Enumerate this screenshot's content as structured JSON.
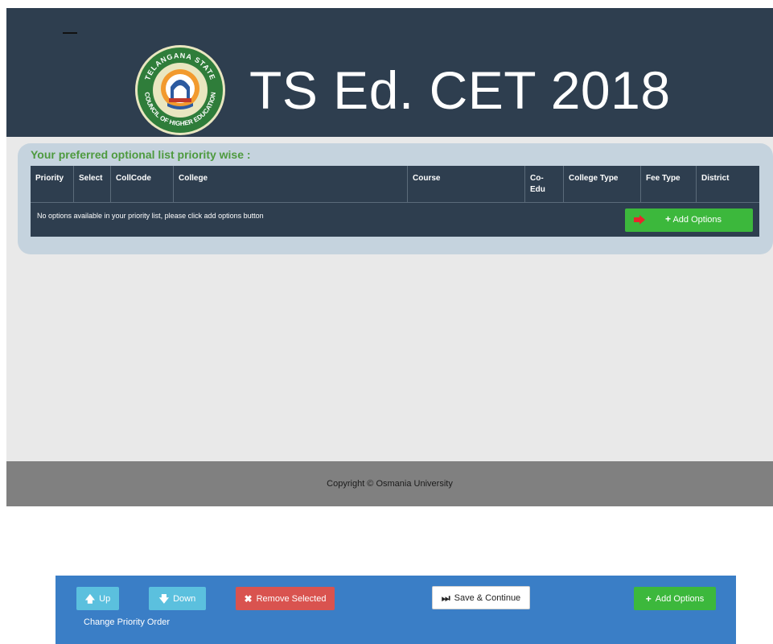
{
  "header": {
    "title": "TS Ed. CET 2018",
    "logo": {
      "icon": "council-seal-logo",
      "ring_top": "TELANGANA STATE",
      "ring_bottom": "COUNCIL OF HIGHER EDUCATION"
    }
  },
  "preferences": {
    "heading": "Your preferred optional list priority wise :",
    "columns": [
      "Priority",
      "Select",
      "CollCode",
      "College",
      "Course",
      "Co-Edu",
      "College Type",
      "Fee Type",
      "District"
    ],
    "empty_message": "No options available in your priority list, please click add options button",
    "add_options_label": "Add Options"
  },
  "footer": {
    "copyright": "Copyright © Osmania University"
  },
  "actions": {
    "up_label": "Up",
    "down_label": "Down",
    "remove_label": "Remove Selected",
    "save_label": "Save & Continue",
    "add_options_label": "Add Options",
    "change_order_label": "Change Priority Order"
  },
  "colors": {
    "header_bg": "#2e3e4f",
    "accent_green": "#3cb83c",
    "action_bar_bg": "#3a7ec6",
    "danger": "#d9534f",
    "info": "#5bc0de"
  }
}
